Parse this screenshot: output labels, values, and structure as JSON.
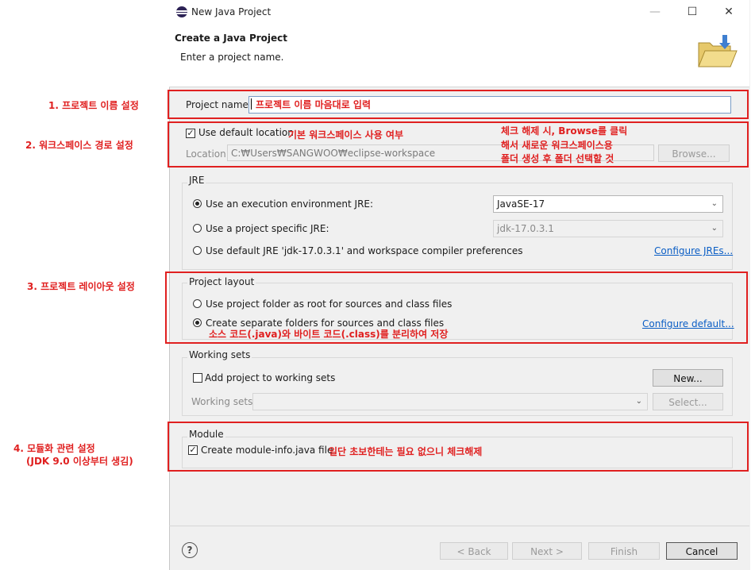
{
  "window": {
    "title": "New Java Project",
    "minimize": "—",
    "maximize": "☐",
    "close": "✕"
  },
  "header": {
    "title": "Create a Java Project",
    "message": "Enter a project name."
  },
  "project": {
    "label": "Project name:",
    "value": "프로젝트 이름 마음대로 입력"
  },
  "location": {
    "use_default_label": "Use default location",
    "use_default_checked": true,
    "location_label": "Location:",
    "location_value": "C:₩Users₩SANGWOO₩eclipse-workspace",
    "browse": "Browse..."
  },
  "jre": {
    "group": "JRE",
    "opt_env": "Use an execution environment JRE:",
    "opt_specific": "Use a project specific JRE:",
    "opt_default": "Use default JRE 'jdk-17.0.3.1' and workspace compiler preferences",
    "env_value": "JavaSE-17",
    "specific_value": "jdk-17.0.3.1",
    "configure": "Configure JREs..."
  },
  "layout": {
    "group": "Project layout",
    "opt_root": "Use project folder as root for sources and class files",
    "opt_separate": "Create separate folders for sources and class files",
    "configure": "Configure default..."
  },
  "working_sets": {
    "group": "Working sets",
    "add_label": "Add project to working sets",
    "new": "New...",
    "sets_label": "Working sets:",
    "select": "Select..."
  },
  "module": {
    "group": "Module",
    "create_label": "Create module-info.java file"
  },
  "footer": {
    "help": "?",
    "back": "< Back",
    "next": "Next >",
    "finish": "Finish",
    "cancel": "Cancel"
  },
  "annotations": {
    "left1": "1. 프로젝트 이름 설정",
    "left2": "2. 워크스페이스 경로 설정",
    "left3": "3. 프로젝트 레이아웃 설정",
    "left4a": "4. 모듈화 관련 설정",
    "left4b": "(JDK 9.0 이상부터 생김)",
    "default_location_note": "기본 워크스페이스 사용 여부",
    "uncheck_note_1": "체크 해제 시, Browse를 클릭",
    "uncheck_note_2": "해서 새로운 워크스페이스용",
    "uncheck_note_3": "폴더 생성 후 폴더 선택할 것",
    "layout_note": "소스 코드(.java)와 바이트 코드(.class)를 분리하여 저장",
    "module_note": "일단 초보한테는 필요 없으니 체크해제"
  }
}
